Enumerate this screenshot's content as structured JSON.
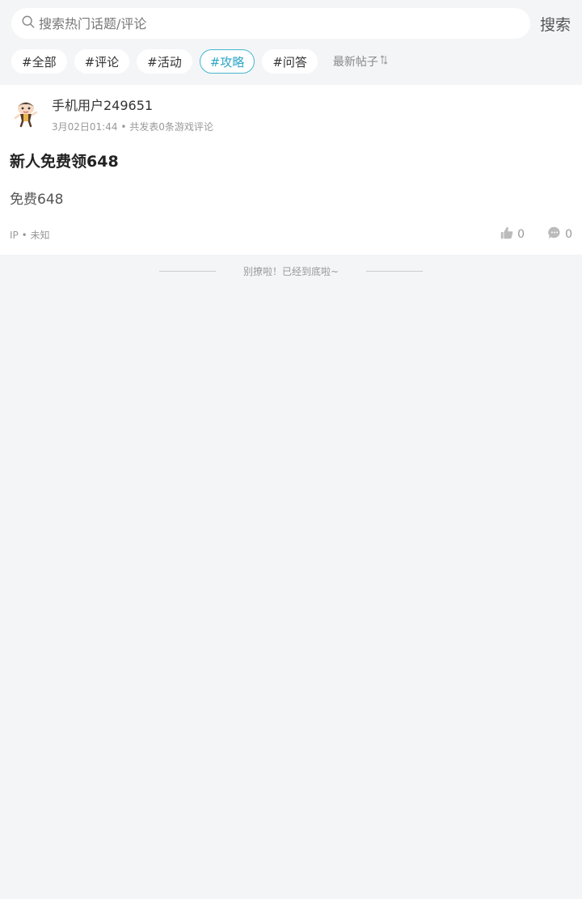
{
  "search": {
    "placeholder": "搜索热门话题/评论",
    "button_label": "搜索"
  },
  "tags": [
    {
      "label": "#全部",
      "active": false
    },
    {
      "label": "#评论",
      "active": false
    },
    {
      "label": "#活动",
      "active": false
    },
    {
      "label": "#攻略",
      "active": true
    },
    {
      "label": "#问答",
      "active": false
    }
  ],
  "sort_label": "最新帖子",
  "posts": [
    {
      "username": "手机用户249651",
      "date": "3月02日01:44",
      "meta_sep": "•",
      "meta_extra": "共发表0条游戏评论",
      "title": "新人免费领648",
      "body": "免费648",
      "ip_label": "IP",
      "ip_value": "未知",
      "likes": "0",
      "comments": "0"
    }
  ],
  "end_text": "别撩啦！已经到底啦~",
  "colors": {
    "accent": "#2fa6c4",
    "background": "#f4f5f7"
  },
  "icons": {
    "search": "search-icon",
    "sort": "sort-icon",
    "like": "thumbs-up-icon",
    "comment": "comment-icon"
  }
}
